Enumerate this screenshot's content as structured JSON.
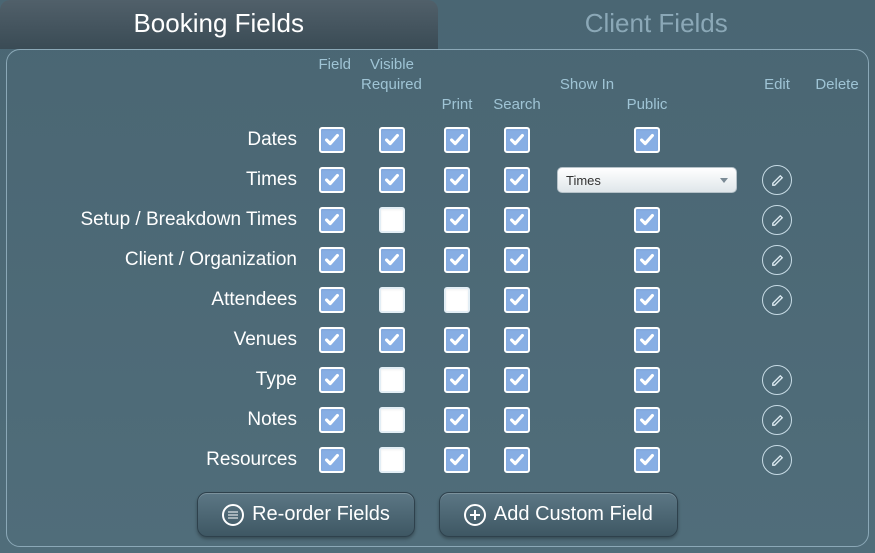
{
  "tabs": {
    "booking": "Booking Fields",
    "client": "Client Fields"
  },
  "headers": {
    "field": "Field",
    "visible": "Visible",
    "required": "Required",
    "showin": "Show In",
    "print": "Print",
    "search": "Search",
    "public": "Public",
    "edit": "Edit",
    "delete": "Delete"
  },
  "rows": [
    {
      "label": "Dates",
      "visible": true,
      "required": true,
      "print": true,
      "search": true,
      "public_type": "check",
      "public_checked": true,
      "edit": false
    },
    {
      "label": "Times",
      "visible": true,
      "required": true,
      "print": true,
      "search": true,
      "public_type": "dropdown",
      "public_value": "Times",
      "edit": true
    },
    {
      "label": "Setup / Breakdown Times",
      "visible": true,
      "required": false,
      "print": true,
      "search": true,
      "public_type": "check",
      "public_checked": true,
      "edit": true
    },
    {
      "label": "Client / Organization",
      "visible": true,
      "required": true,
      "print": true,
      "search": true,
      "public_type": "check",
      "public_checked": true,
      "edit": true
    },
    {
      "label": "Attendees",
      "visible": true,
      "required": false,
      "print": false,
      "search": true,
      "public_type": "check",
      "public_checked": true,
      "edit": true
    },
    {
      "label": "Venues",
      "visible": true,
      "required": true,
      "print": true,
      "search": true,
      "public_type": "check",
      "public_checked": true,
      "edit": false
    },
    {
      "label": "Type",
      "visible": true,
      "required": false,
      "print": true,
      "search": true,
      "public_type": "check",
      "public_checked": true,
      "edit": true
    },
    {
      "label": "Notes",
      "visible": true,
      "required": false,
      "print": true,
      "search": true,
      "public_type": "check",
      "public_checked": true,
      "edit": true
    },
    {
      "label": "Resources",
      "visible": true,
      "required": false,
      "print": true,
      "search": true,
      "public_type": "check",
      "public_checked": true,
      "edit": true
    }
  ],
  "buttons": {
    "reorder": "Re-order Fields",
    "add": "Add Custom Field"
  }
}
